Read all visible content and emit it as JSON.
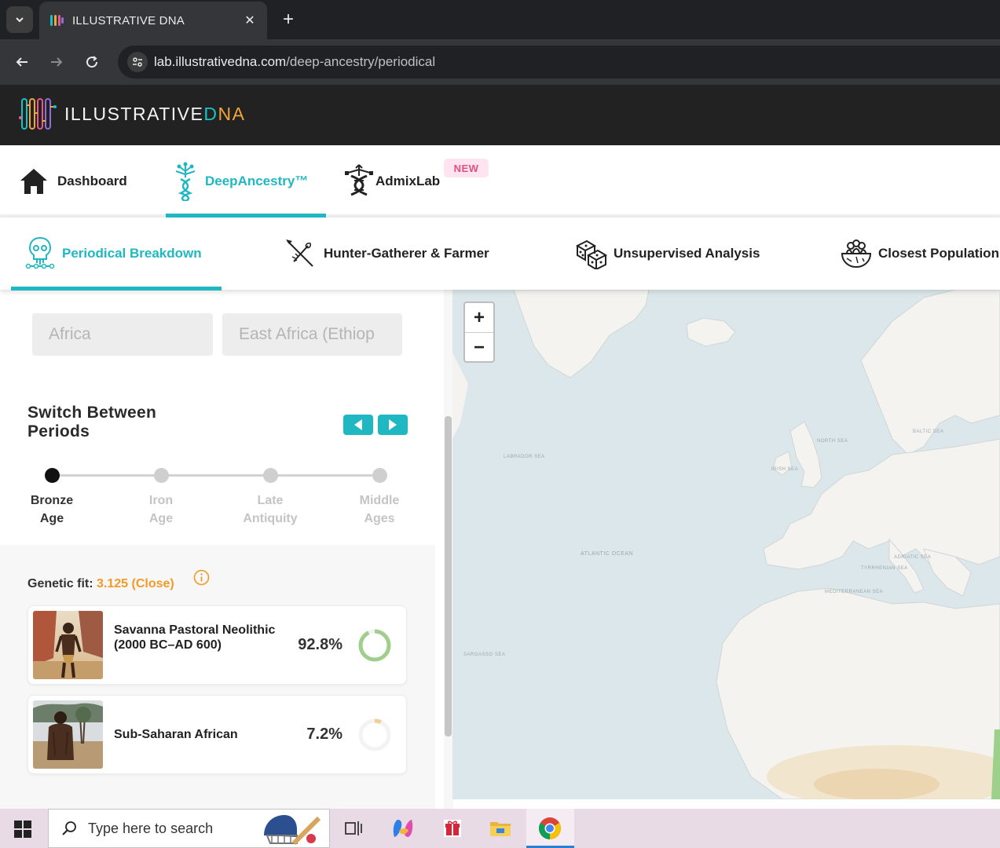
{
  "browser": {
    "tab_title": "ILLUSTRATIVE DNA",
    "url_host": "lab.illustrativedna.com",
    "url_path": "/deep-ancestry/periodical"
  },
  "site": {
    "logo_text_main": "ILLUSTRATIVE",
    "logo_text_d": "D",
    "logo_text_na": "NA"
  },
  "main_nav": {
    "items": [
      {
        "label": "Dashboard",
        "icon": "home-icon"
      },
      {
        "label": "DeepAncestry™",
        "icon": "dna-tree-icon"
      },
      {
        "label": "AdmixLab",
        "icon": "admix-dna-icon"
      }
    ],
    "new_badge": "NEW"
  },
  "sub_nav": {
    "items": [
      {
        "label": "Periodical Breakdown",
        "icon": "skull-icon"
      },
      {
        "label": "Hunter-Gatherer & Farmer",
        "icon": "spear-icon"
      },
      {
        "label": "Unsupervised Analysis",
        "icon": "dice-icon"
      },
      {
        "label": "Closest Population",
        "icon": "people-bowl-icon"
      }
    ]
  },
  "filters": {
    "region": "Africa",
    "subregion": "East Africa (Ethiop"
  },
  "periods": {
    "title": "Switch Between Periods",
    "items": [
      {
        "line1": "Bronze",
        "line2": "Age"
      },
      {
        "line1": "Iron",
        "line2": "Age"
      },
      {
        "line1": "Late",
        "line2": "Antiquity"
      },
      {
        "line1": "Middle",
        "line2": "Ages"
      }
    ],
    "active_index": 0
  },
  "results": {
    "fit_label": "Genetic fit:",
    "fit_value": "3.125 (Close)",
    "components": [
      {
        "name": "Savanna Pastoral Neolithic (2000 BC–AD 600)",
        "percent_text": "92.8%",
        "percent": 92.8,
        "color": "#9fcf8a"
      },
      {
        "name": "Sub-Saharan African",
        "percent_text": "7.2%",
        "percent": 7.2,
        "color": "#f2cf95"
      }
    ]
  },
  "map": {
    "zoom_in": "+",
    "zoom_out": "−",
    "labels": {
      "labrador": "LABRADOR SEA",
      "north": "NORTH SEA",
      "baltic": "BALTIC SEA",
      "irish": "IRISH SEA",
      "atlantic": "ATLANTIC OCEAN",
      "adriatic": "ADRIATIC SEA",
      "tyrrhenian": "TYRRHENIAN SEA",
      "mediterranean": "MEDITERRANEAN SEA",
      "sargasso": "SARGASSO SEA"
    }
  },
  "taskbar": {
    "search_placeholder": "Type here to search"
  },
  "colors": {
    "accent": "#1fb8c2",
    "fit_value": "#f29a26",
    "new_badge_bg": "#fde4ee",
    "new_badge_text": "#e0507f"
  }
}
